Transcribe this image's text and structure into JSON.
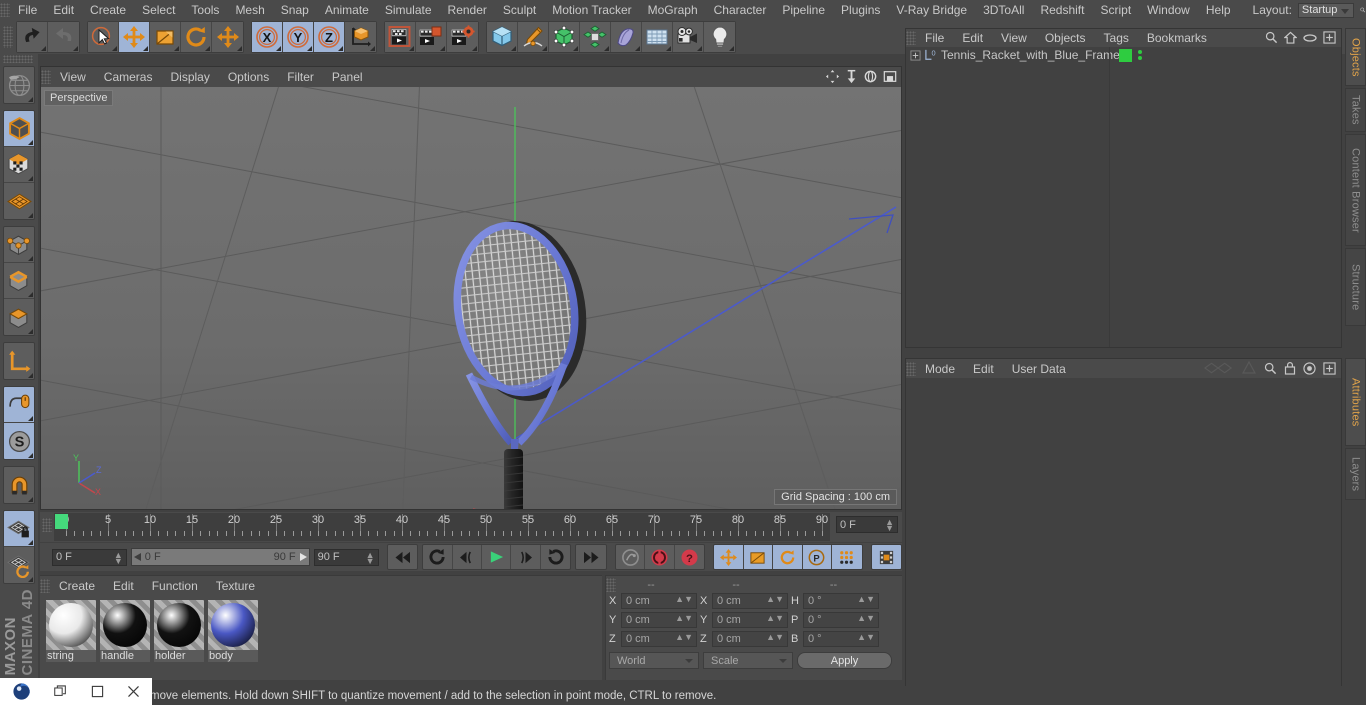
{
  "menubar": {
    "items": [
      "File",
      "Edit",
      "Create",
      "Select",
      "Tools",
      "Mesh",
      "Snap",
      "Animate",
      "Simulate",
      "Render",
      "Sculpt",
      "Motion Tracker",
      "MoGraph",
      "Character",
      "Pipeline",
      "Plugins",
      "V-Ray Bridge",
      "3DToAll",
      "Redshift",
      "Script",
      "Window",
      "Help"
    ],
    "layout_label": "Layout:",
    "layout_value": "Startup",
    "search_icon": "search-icon"
  },
  "toolbar": {
    "groups": [
      {
        "name": "undo-redo",
        "buttons": [
          {
            "icon": "undo-icon",
            "label": "Undo",
            "active": false
          },
          {
            "icon": "redo-icon",
            "label": "Redo",
            "active": false
          }
        ]
      },
      {
        "name": "transform-tools",
        "buttons": [
          {
            "icon": "live-selection-icon",
            "label": "Live Selection",
            "active": false
          },
          {
            "icon": "move-icon",
            "label": "Move",
            "active": true
          },
          {
            "icon": "scale-icon",
            "label": "Scale",
            "active": false
          },
          {
            "icon": "rotate-icon",
            "label": "Rotate",
            "active": false
          },
          {
            "icon": "move-alt-icon",
            "label": "Move Tool Options",
            "active": false
          }
        ]
      },
      {
        "name": "axis-locks",
        "buttons": [
          {
            "icon": "x-axis-icon",
            "label": "X",
            "active": true
          },
          {
            "icon": "y-axis-icon",
            "label": "Y",
            "active": true
          },
          {
            "icon": "z-axis-icon",
            "label": "Z",
            "active": true
          },
          {
            "icon": "world-coordinate-icon",
            "label": "World/Object Coordinate System",
            "active": false
          }
        ]
      },
      {
        "name": "render-tools",
        "buttons": [
          {
            "icon": "render-view-icon",
            "label": "Render View",
            "active": false
          },
          {
            "icon": "render-region-icon",
            "label": "Render to Picture Viewer",
            "active": false
          },
          {
            "icon": "render-settings-icon",
            "label": "Edit Render Settings",
            "active": false
          }
        ]
      },
      {
        "name": "create-objects",
        "buttons": [
          {
            "icon": "cube-primitive-icon",
            "label": "Add Cube Object",
            "active": false
          },
          {
            "icon": "pen-spline-icon",
            "label": "Add Spline",
            "active": false
          },
          {
            "icon": "generator-icon",
            "label": "Add Generator",
            "active": false
          },
          {
            "icon": "array-icon",
            "label": "Add Modeling Object",
            "active": false
          },
          {
            "icon": "deformer-icon",
            "label": "Add Deformer",
            "active": false
          },
          {
            "icon": "scene-icon",
            "label": "Add Scene Object",
            "active": false
          },
          {
            "icon": "camera-icon",
            "label": "Add Camera Object",
            "active": false
          },
          {
            "icon": "light-icon",
            "label": "Add Light Object",
            "active": false
          }
        ]
      }
    ]
  },
  "left_toolbar": {
    "groups": [
      {
        "buttons": [
          {
            "icon": "make-editable-icon",
            "label": "Make Editable",
            "active": false
          }
        ]
      },
      {
        "buttons": [
          {
            "icon": "model-mode-icon",
            "label": "Model Mode",
            "active": true
          },
          {
            "icon": "texture-mode-icon",
            "label": "Texture Mode",
            "active": false
          },
          {
            "icon": "polygon-grid-icon",
            "label": "Workplane",
            "active": false
          }
        ]
      },
      {
        "buttons": [
          {
            "icon": "points-mode-icon",
            "label": "Points Mode",
            "active": false
          },
          {
            "icon": "edges-mode-icon",
            "label": "Edges Mode",
            "active": false
          },
          {
            "icon": "polygons-mode-icon",
            "label": "Polygons Mode",
            "active": false
          }
        ]
      },
      {
        "buttons": [
          {
            "icon": "axis-modify-icon",
            "label": "Enable Axis Modification",
            "active": false
          }
        ]
      },
      {
        "buttons": [
          {
            "icon": "viewport-solo-icon",
            "label": "Enable Snapping",
            "active": true
          },
          {
            "icon": "soft-selection-icon",
            "label": "Soft Selection",
            "active": true
          }
        ]
      },
      {
        "buttons": [
          {
            "icon": "magnet-icon",
            "label": "Magnet",
            "active": false
          }
        ]
      },
      {
        "buttons": [
          {
            "icon": "lock-workplane-icon",
            "label": "Lock Workplane",
            "active": true
          },
          {
            "icon": "workplane-rotate-icon",
            "label": "Planar Workplane Rotation",
            "active": false
          }
        ]
      }
    ],
    "brand_line1": "MAXON",
    "brand_line2": "CINEMA 4D"
  },
  "viewport": {
    "menu": [
      "View",
      "Cameras",
      "Display",
      "Options",
      "Filter",
      "Panel"
    ],
    "camera_label": "Perspective",
    "grid_spacing": "Grid Spacing : 100 cm",
    "icons": [
      "pan-icon",
      "zoom-icon",
      "rotate-view-icon",
      "maximize-view-icon"
    ],
    "axis_gizmo": {
      "x": "X",
      "y": "Y",
      "z": "Z"
    },
    "scene_object": "Tennis Racket with Blue Frame",
    "colors": {
      "frame": "#6f7fd8",
      "strings": "#e4e4e4",
      "handle": "#242424",
      "bg": "#6e6e6e",
      "axis_x": "#c4474c",
      "axis_y": "#4cc45a",
      "axis_z": "#4a5ad0"
    }
  },
  "timeline": {
    "ticks": [
      0,
      5,
      10,
      15,
      20,
      25,
      30,
      35,
      40,
      45,
      50,
      55,
      60,
      65,
      70,
      75,
      80,
      85,
      90
    ],
    "current_frame": "0 F",
    "playhead_frame": 0
  },
  "animbar": {
    "current_frame": "0 F",
    "range_start": "0 F",
    "range_end": "90 F",
    "max_frame": "90 F",
    "transport": [
      {
        "icon": "go-to-start-icon",
        "label": "Go to Start",
        "active": false
      },
      {
        "icon": "play-back-icon",
        "label": "Play Backwards",
        "active": false
      },
      {
        "icon": "prev-frame-icon",
        "label": "Go to Previous Frame",
        "active": false
      },
      {
        "icon": "play-forward-icon",
        "label": "Play Forwards",
        "active": false
      },
      {
        "icon": "next-frame-icon",
        "label": "Go to Next Frame",
        "active": false
      },
      {
        "icon": "loop-icon",
        "label": "Loop",
        "active": false
      },
      {
        "icon": "go-to-end-icon",
        "label": "Go to End",
        "active": false
      }
    ],
    "keyframes": [
      {
        "icon": "record-key-icon",
        "label": "Record Active Objects",
        "active": false
      },
      {
        "icon": "autokey-icon",
        "label": "Autokeying",
        "active": false
      },
      {
        "icon": "keyframe-selection-icon",
        "label": "Keyframe Selection",
        "active": false
      }
    ],
    "key_toggles": [
      {
        "icon": "position-key-icon",
        "label": "Position",
        "active": true
      },
      {
        "icon": "scale-key-icon",
        "label": "Scale",
        "active": true
      },
      {
        "icon": "rotation-key-icon",
        "label": "Rotation",
        "active": true
      },
      {
        "icon": "param-key-icon",
        "label": "Parameter",
        "active": true
      },
      {
        "icon": "pla-key-icon",
        "label": "Point Level Animation",
        "active": true
      }
    ],
    "end": [
      {
        "icon": "timeline-icon",
        "label": "Timeline",
        "active": true
      }
    ]
  },
  "material_manager": {
    "menu": [
      "Create",
      "Edit",
      "Function",
      "Texture"
    ],
    "materials": [
      {
        "name": "string",
        "color": "#e9e9e9"
      },
      {
        "name": "handle",
        "color": "#111111"
      },
      {
        "name": "holder",
        "color": "#121212"
      },
      {
        "name": "body",
        "color": "#4a58c4"
      }
    ]
  },
  "coordinates": {
    "headers": [
      "--",
      "--",
      "--"
    ],
    "position": {
      "label_x": "X",
      "label_y": "Y",
      "label_z": "Z",
      "x": "0 cm",
      "y": "0 cm",
      "z": "0 cm"
    },
    "size": {
      "label_x": "X",
      "label_y": "Y",
      "label_z": "Z",
      "x": "0 cm",
      "y": "0 cm",
      "z": "0 cm"
    },
    "rotation": {
      "label_h": "H",
      "label_p": "P",
      "label_b": "B",
      "h": "0 °",
      "p": "0 °",
      "b": "0 °"
    },
    "system": "World",
    "mode": "Scale",
    "apply": "Apply"
  },
  "object_manager": {
    "menu": [
      "File",
      "Edit",
      "View",
      "Objects",
      "Tags",
      "Bookmarks"
    ],
    "icons": [
      "search-icon",
      "home-icon",
      "ellipse-icon",
      "plus-box-icon"
    ],
    "objects": [
      {
        "name": "Tennis_Racket_with_Blue_Frame",
        "layer": "0",
        "visible": true,
        "color": "#2ecc40"
      }
    ]
  },
  "attribute_manager": {
    "menu": [
      "Mode",
      "Edit",
      "User Data"
    ],
    "icons": [
      "interpolation-icon",
      "cone-icon",
      "search-icon",
      "lock-icon",
      "target-icon",
      "plus-box-icon"
    ]
  },
  "vertical_tabs": [
    {
      "label": "Objects",
      "selected": true
    },
    {
      "label": "Takes",
      "selected": false
    },
    {
      "label": "Content Browser",
      "selected": false
    },
    {
      "label": "Structure",
      "selected": false
    },
    {
      "label": "Attributes",
      "selected": true
    },
    {
      "label": "Layers",
      "selected": false
    }
  ],
  "statusbar": {
    "text": "move elements. Hold down SHIFT to quantize movement / add to the selection in point mode, CTRL to remove."
  },
  "taskbar": {
    "icons": [
      "c4d-app-icon",
      "restore-window-icon",
      "maximize-window-icon",
      "close-window-icon"
    ]
  }
}
